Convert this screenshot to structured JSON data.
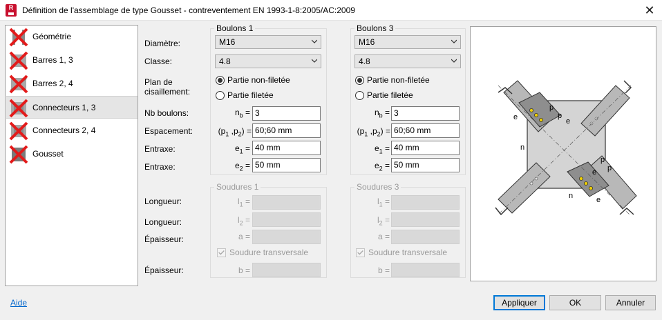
{
  "window": {
    "title": "Définition de l'assemblage de type Gousset - contreventement   EN 1993-1-8:2005/AC:2009",
    "app_icon_letter": "R"
  },
  "nav": {
    "items": [
      {
        "label": "Géométrie",
        "icon": "error-x-icon"
      },
      {
        "label": "Barres 1, 3",
        "icon": "error-x-icon"
      },
      {
        "label": "Barres 2, 4",
        "icon": "error-x-icon"
      },
      {
        "label": "Connecteurs 1, 3",
        "icon": "error-x-icon",
        "selected": true
      },
      {
        "label": "Connecteurs 2, 4",
        "icon": "error-x-icon"
      },
      {
        "label": "Gousset",
        "icon": "error-x-icon"
      }
    ]
  },
  "labels": {
    "diametre": "Diamètre:",
    "classe": "Classe:",
    "plan": "Plan de cisaillement:",
    "nb_boulons": "Nb boulons:",
    "espacement": "Espacement:",
    "entraxe1": "Entraxe:",
    "entraxe2": "Entraxe:",
    "longueur1": "Longueur:",
    "longueur2": "Longueur:",
    "epaisseur1": "Épaisseur:",
    "epaisseur2": "Épaisseur:"
  },
  "boulons1": {
    "title": "Boulons 1",
    "diametre": "M16",
    "classe": "4.8",
    "radio_nonfiletee": "Partie non-filetée",
    "radio_filetee": "Partie filetée",
    "selected_radio": "nonfiletee",
    "nb": "3",
    "espacement": "60;60 mm",
    "e1": "40 mm",
    "e2": "50 mm"
  },
  "boulons3": {
    "title": "Boulons 3",
    "diametre": "M16",
    "classe": "4.8",
    "radio_nonfiletee": "Partie non-filetée",
    "radio_filetee": "Partie filetée",
    "selected_radio": "nonfiletee",
    "nb": "3",
    "espacement": "60;60 mm",
    "e1": "40 mm",
    "e2": "50 mm"
  },
  "soudures1": {
    "title": "Soudures 1",
    "checkbox": "Soudure transversale",
    "checked": true,
    "disabled": true
  },
  "soudures3": {
    "title": "Soudures 3",
    "checkbox": "Soudure transversale",
    "checked": true,
    "disabled": true
  },
  "symbols": {
    "nb": "n",
    "nb_sub": "b",
    "esp_open": "(p",
    "esp_sub1": "1",
    "esp_mid": " ,p",
    "esp_sub2": "2",
    "esp_close": ") =",
    "e": "e",
    "sub1": "1",
    "sub2": "2",
    "eq": "=",
    "l": "l",
    "a": "a =",
    "b": "b ="
  },
  "diagram": {
    "labels": [
      "p",
      "p",
      "e",
      "e",
      "n",
      "n",
      "e",
      "p",
      "p",
      "e"
    ],
    "colors": {
      "plate": "#d4d4d4",
      "bar": "#b8b8b8",
      "bolt": "#f0d000"
    }
  },
  "footer": {
    "help": "Aide",
    "apply": "Appliquer",
    "ok": "OK",
    "cancel": "Annuler"
  }
}
